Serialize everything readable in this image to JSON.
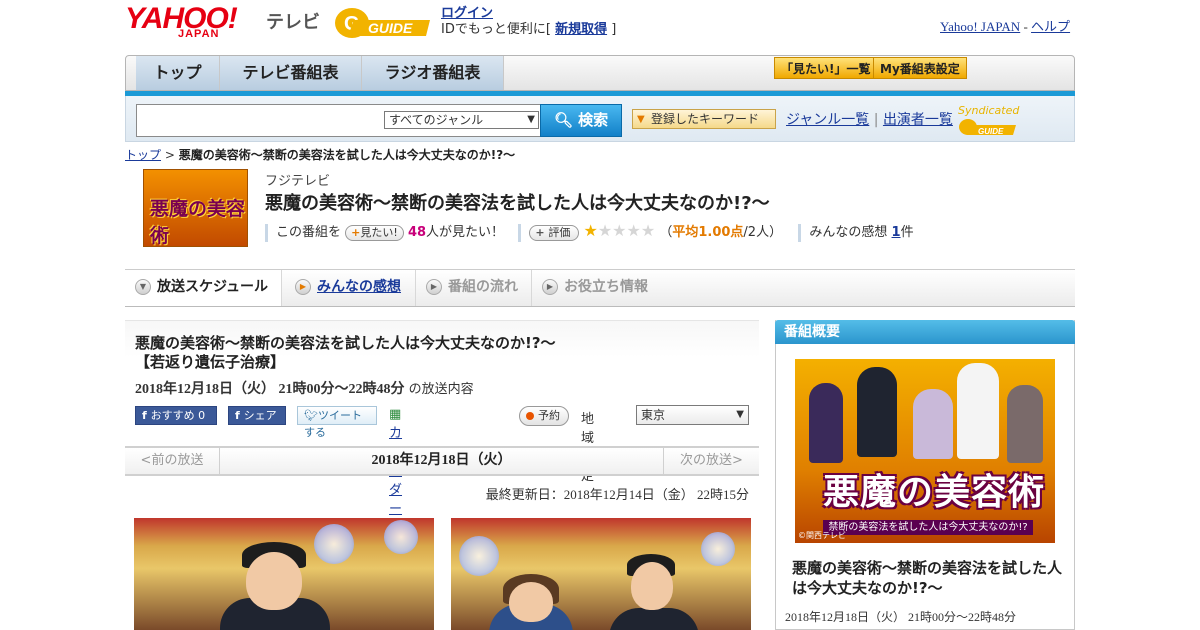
{
  "header": {
    "logo_text": "YAHOO!",
    "logo_sub": "JAPAN",
    "service": "テレビ",
    "gguide_logo": "G GUIDE",
    "login": "ログイン",
    "login_note": "IDでもっと便利に[",
    "register": "新規取得",
    "login_note_end": "]",
    "yahoo_link": "Yahoo! JAPAN",
    "sep": "-",
    "help_link": "ヘルプ"
  },
  "nav": {
    "tabs": [
      "トップ",
      "テレビ番組表",
      "ラジオ番組表"
    ],
    "want_list": "「見たい!」一覧",
    "my_schedule": "My番組表設定"
  },
  "search": {
    "genre_selected": "すべてのジャンル",
    "search_button": "検索",
    "keyword_button": "登録したキーワード",
    "genre_list": "ジャンル一覧",
    "divider": "|",
    "cast_list": "出演者一覧",
    "syndicated": "Syndicated"
  },
  "breadcrumb": {
    "top": "トップ",
    "sep": ">",
    "current": "悪魔の美容術～禁断の美容法を試した人は今大丈夫なのか!?～"
  },
  "program": {
    "thumb_title": "悪魔の美容術",
    "station": "フジテレビ",
    "title": "悪魔の美容術～禁断の美容法を試した人は今大丈夫なのか!?～",
    "this_program": "この番組を",
    "want_button": "見たい!",
    "want_count": "48",
    "want_suffix": "人が見たい！",
    "rate_button": "評価",
    "rating": 1,
    "rating_max": 5,
    "avg_prefix": "（",
    "avg_label": "平均1.00点",
    "avg_suffix": "/2人）",
    "impressions_label": "みんなの感想",
    "impressions_count": "1",
    "impressions_unit": "件"
  },
  "tabs": [
    {
      "label": "放送スケジュール"
    },
    {
      "label": "みんなの感想"
    },
    {
      "label": "番組の流れ"
    },
    {
      "label": "お役立ち情報"
    }
  ],
  "episode": {
    "title_line1": "悪魔の美容術～禁断の美容法を試した人は今大丈夫なのか!?～",
    "title_line2": "【若返り遺伝子治療】",
    "datetime": "2018年12月18日（火） 21時00分～22時48分",
    "datetime_suffix": "の放送内容",
    "fb_recommend": "おすすめ 0",
    "fb_share": "シェア",
    "tweet": "ツイートする",
    "calendar": "カレンダーに登録",
    "reserve": "予約",
    "region_label": "地域設定",
    "region_value": "東京"
  },
  "date_nav": {
    "prev": "<前の放送",
    "current": "2018年12月18日（火）",
    "next": "次の放送>",
    "updated": "最終更新日：2018年12月14日（金） 22時15分"
  },
  "sidebar": {
    "header": "番組概要",
    "poster_logo": "悪魔の美容術",
    "poster_sub": "禁断の美容法を試した人は今大丈夫なのか!?",
    "poster_credit": "©関西テレビ",
    "title": "悪魔の美容術～禁断の美容法を試した人は今大丈夫なのか!?～",
    "date": "2018年12月18日（火） 21時00分～22時48分"
  },
  "colors": {
    "brand_red": "#e60012",
    "accent_blue": "#1c9ad6",
    "gguide_yellow": "#f2b300",
    "link": "#1a3a9a"
  }
}
